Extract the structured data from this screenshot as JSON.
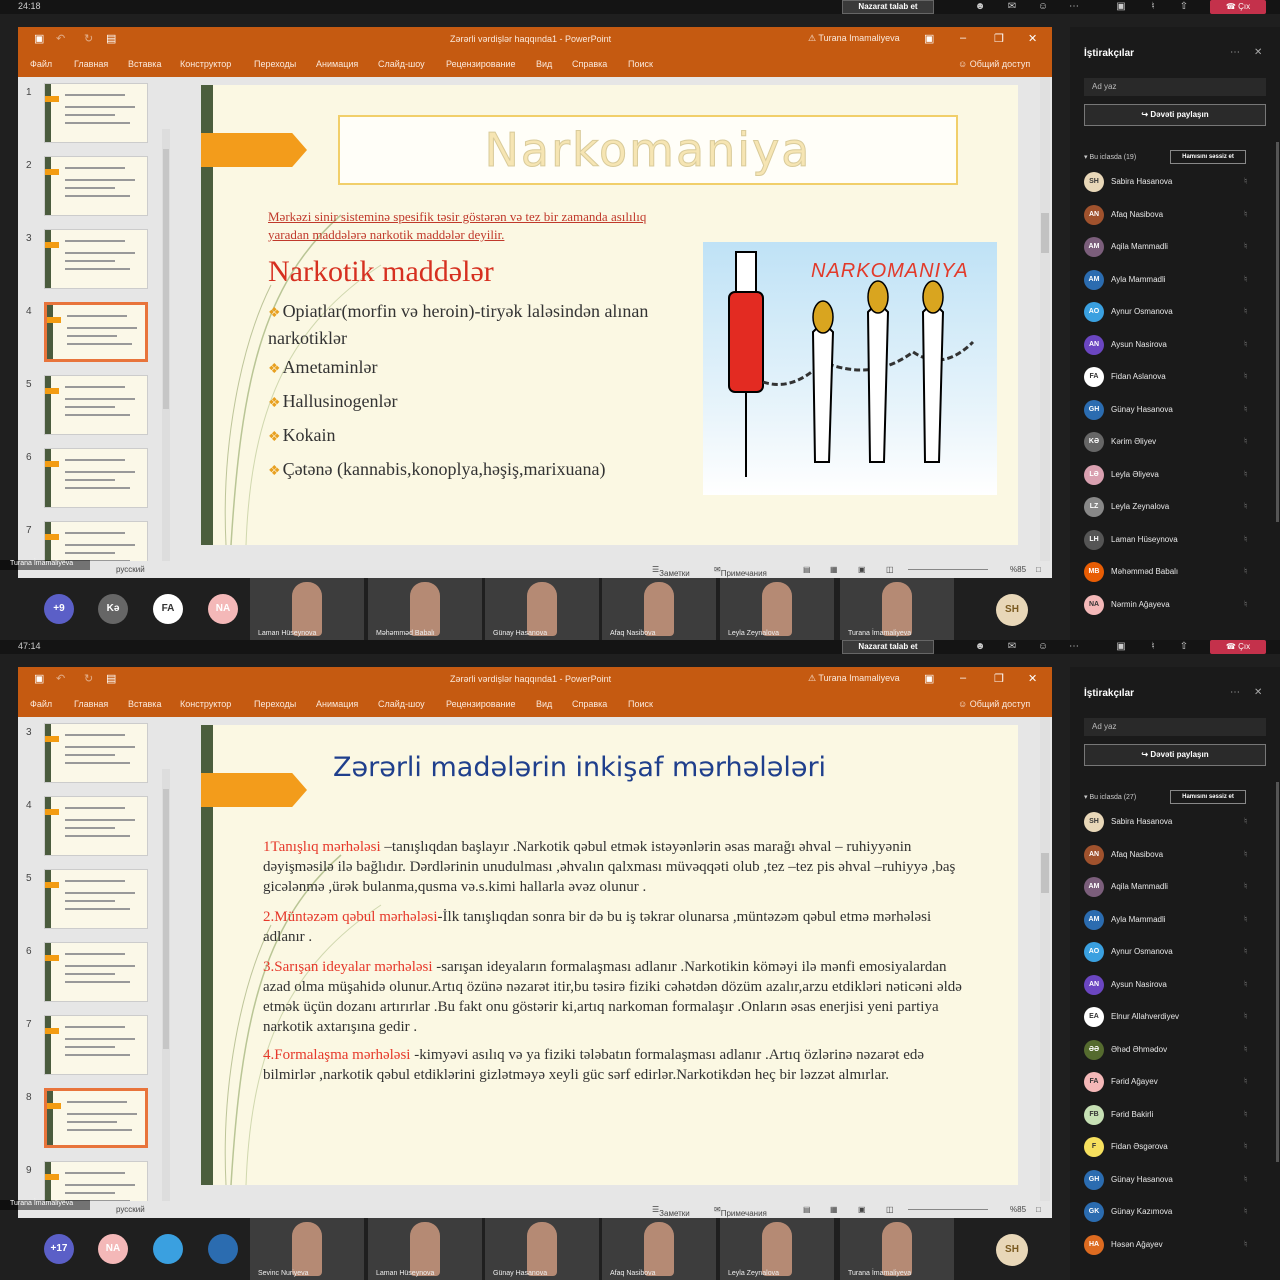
{
  "meeting": {
    "request_control": "Nazarat talab et",
    "leave": "Çıx",
    "participants_title": "İştirakçılar",
    "name_placeholder": "Ad yaz",
    "share_invite": "Dəvəti paylaşın",
    "mute_all": "Hamısını səssiz et"
  },
  "ppt": {
    "doc_title": "Zərərli vərdişlər haqqında1  -  PowerPoint",
    "user": "Turana Imamaliyeva",
    "menu": [
      "Файл",
      "Главная",
      "Вставка",
      "Конструктор",
      "Переходы",
      "Анимация",
      "Слайд-шоу",
      "Рецензирование",
      "Вид",
      "Справка",
      "Поиск"
    ],
    "share": "Общий доступ",
    "status": {
      "lang": "русский",
      "notes": "Заметки",
      "comments": "Примечания",
      "zoom": "%85"
    }
  },
  "panels": [
    {
      "timer": "24:18",
      "presenter": "Turana İmamaliyeva",
      "thumb_numbers": [
        "1",
        "2",
        "3",
        "4",
        "5",
        "6",
        "7"
      ],
      "slide": {
        "title": "Narkomaniya",
        "definition": "Mərkəzi sinir sisteminə spesifik təsir göstərən və tez bir zamanda asılılıq yaradan maddələrə narkotik maddələr deyilir.",
        "heading": "Narkotik maddələr",
        "bullets": [
          "Opiatlar(morfin və heroin)-tiryək laləsindən alınan narkotiklər",
          "Ametaminlər",
          "Hallusinogenlər",
          "Kokain",
          "Çətənə (kannabis,konoplya,həşiş,marixuana)"
        ],
        "cartoon_label": "NARKOMANIYA"
      },
      "section": "Bu iclasda (19)",
      "people": [
        {
          "name": "Sabira Hasanova",
          "ini": "SH",
          "color": "#e8d7b8"
        },
        {
          "name": "Afaq Nasibova",
          "ini": "AN",
          "color": "#a0522d"
        },
        {
          "name": "Aqila Mammadli",
          "ini": "AM",
          "color": "#7b5e7b"
        },
        {
          "name": "Ayla Mammadli",
          "ini": "AM",
          "color": "#2b6cb0"
        },
        {
          "name": "Aynur Osmanova",
          "ini": "AO",
          "color": "#3aa0e0"
        },
        {
          "name": "Aysun Nasirova",
          "ini": "AN",
          "color": "#6b46c1"
        },
        {
          "name": "Fidan Aslanova",
          "ini": "FA",
          "color": "#ffffff"
        },
        {
          "name": "Günay Hasanova",
          "ini": "GH",
          "color": "#2b6cb0"
        },
        {
          "name": "Kərim Əliyev",
          "ini": "KƏ",
          "color": "#666666"
        },
        {
          "name": "Leyla Əliyeva",
          "ini": "LƏ",
          "color": "#d9a0b0"
        },
        {
          "name": "Leyla Zeynalova",
          "ini": "LZ",
          "color": "#888888"
        },
        {
          "name": "Laman Hüseynova",
          "ini": "LH",
          "color": "#555555"
        },
        {
          "name": "Məhəmməd Babalı",
          "ini": "MB",
          "color": "#e85d04"
        },
        {
          "name": "Nərmin Ağayeva",
          "ini": "NA",
          "color": "#f4b8b8"
        }
      ],
      "video": {
        "count": "+9",
        "avatars": [
          {
            "ini": "Kə",
            "color": "#666"
          },
          {
            "ini": "FA",
            "color": "#fff"
          },
          {
            "ini": "NA",
            "color": "#f4b8b8"
          }
        ],
        "tiles": [
          "Laman Hüseynova",
          "Məhəmməd Babalı",
          "Günay Hasanova",
          "Afaq Nasibova",
          "Leyla Zeynalova",
          "Turana İmamaliyeva"
        ],
        "self": "SH"
      }
    },
    {
      "timer": "47:14",
      "presenter": "Turana İmamaliyeva",
      "thumb_numbers": [
        "3",
        "4",
        "5",
        "6",
        "7",
        "8",
        "9"
      ],
      "slide": {
        "title": "Zərərli madələrin inkişaf mərhələləri",
        "paragraphs": [
          {
            "red": "1Tanışlıq mərhələsi",
            "text": " –tanışlıqdan başlayır .Narkotik qəbul etmək istəyənlərin əsas marağı əhval – ruhiyyənin dəyişməsilə ilə bağlıdır. Dərdlərinin unudulması ,əhvalın qalxması müvəqqəti olub ,tez –tez pis əhval –ruhiyyə ,baş gicələnmə ,ürək bulanma,qusma və.s.kimi hallarla əvəz olunur ."
          },
          {
            "red": "2.Müntəzəm qəbul mərhələsi",
            "text": "-İlk tanışlıqdan sonra bir də bu iş təkrar olunarsa ,müntəzəm qəbul etmə mərhələsi adlanır ."
          },
          {
            "red": "3.Sarışan ideyalar mərhələsi",
            "text": " -sarışan ideyaların formalaşması adlanır .Narkotikin köməyi ilə mənfi emosiyalardan azad olma müşahidə olunur.Artıq özünə nəzarət itir,bu təsirə fiziki cəhətdən dözüm azalır,arzu etdikləri nəticəni əldə etmək üçün dozanı artırırlar .Bu fakt onu göstərir ki,artıq narkoman formalaşır .Onların əsas enerjisi yeni partiya narkotik axtarışına gedir ."
          },
          {
            "red": "4.Formalaşma mərhələsi",
            "text": " -kimyəvi asılıq və ya fiziki tələbatın formalaşması   adlanır .Artıq özlərinə nəzarət edə bilmirlər ,narkotik qəbul etdiklərini gizlətməyə xeyli güc sərf edirlər.Narkotikdən heç bir ləzzət almırlar."
          }
        ]
      },
      "section": "Bu iclasda (27)",
      "people": [
        {
          "name": "Sabira Hasanova",
          "ini": "SH",
          "color": "#e8d7b8"
        },
        {
          "name": "Afaq Nasibova",
          "ini": "AN",
          "color": "#a0522d"
        },
        {
          "name": "Aqila Mammadli",
          "ini": "AM",
          "color": "#7b5e7b"
        },
        {
          "name": "Ayla Mammadli",
          "ini": "AM",
          "color": "#2b6cb0"
        },
        {
          "name": "Aynur Osmanova",
          "ini": "AO",
          "color": "#3aa0e0"
        },
        {
          "name": "Aysun Nasirova",
          "ini": "AN",
          "color": "#6b46c1"
        },
        {
          "name": "Elnur Allahverdiyev",
          "ini": "EA",
          "color": "#ffffff"
        },
        {
          "name": "Əhəd Əhmədov",
          "ini": "ƏƏ",
          "color": "#556b2f"
        },
        {
          "name": "Fərid Ağayev",
          "ini": "FA",
          "color": "#f4b8b8"
        },
        {
          "name": "Fərid Bakirli",
          "ini": "FB",
          "color": "#c6e0b4"
        },
        {
          "name": "Fidan Əsgərova",
          "ini": "F",
          "color": "#f6e05e"
        },
        {
          "name": "Günay Hasanova",
          "ini": "GH",
          "color": "#2b6cb0"
        },
        {
          "name": "Günay Kazımova",
          "ini": "GK",
          "color": "#2b6cb0"
        },
        {
          "name": "Həsən Ağayev",
          "ini": "HA",
          "color": "#dd6b20"
        }
      ],
      "video": {
        "count": "+17",
        "avatars": [
          {
            "ini": "NA",
            "color": "#f4b8b8"
          },
          {
            "ini": "",
            "color": "#3aa0e0"
          },
          {
            "ini": "",
            "color": "#2b6cb0"
          }
        ],
        "tiles": [
          "Sevinc Nuriyeva",
          "Laman Hüseynova",
          "Günay Hasanova",
          "Afaq Nasibova",
          "Leyla Zeynalova",
          "Turana İmamaliyeva"
        ],
        "self": "SH"
      }
    }
  ]
}
